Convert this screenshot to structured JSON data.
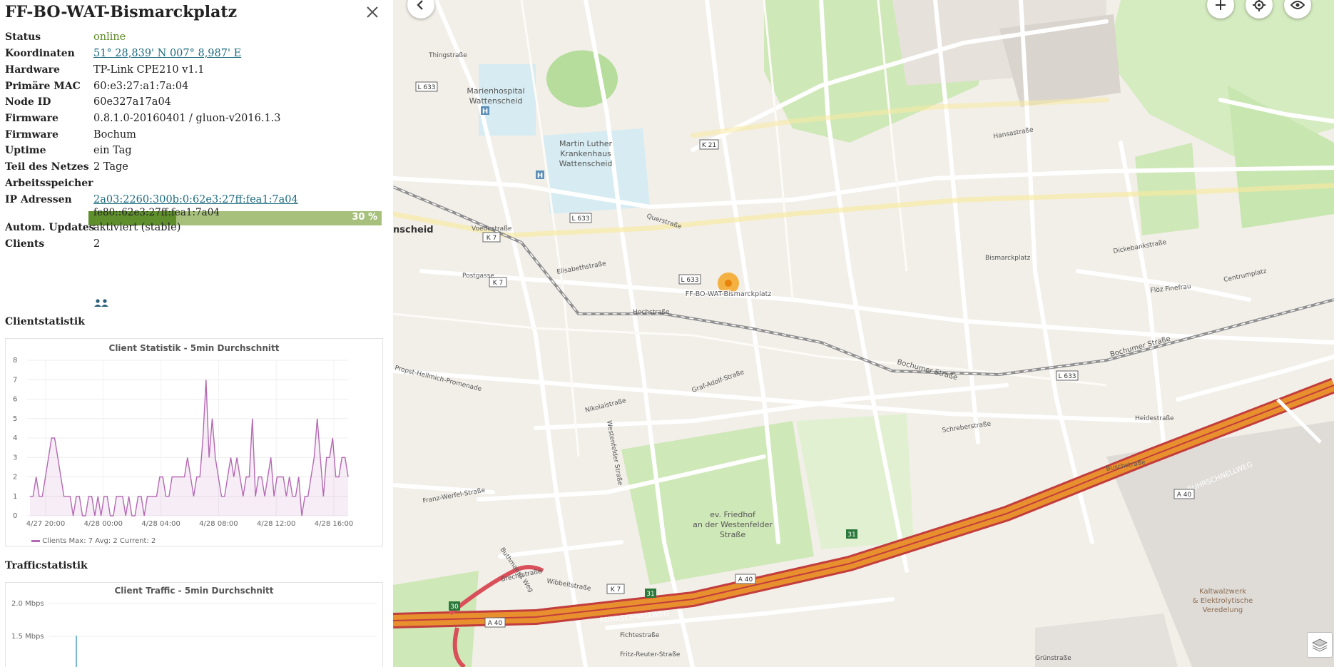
{
  "node": {
    "title": "FF-BO-WAT-Bismarckplatz",
    "fields": {
      "status": {
        "label": "Status",
        "value": "online"
      },
      "coords": {
        "label": "Koordinaten",
        "value": "51° 28,839' N 007° 8,987' E"
      },
      "hardware": {
        "label": "Hardware",
        "value": "TP-Link CPE210 v1.1"
      },
      "mac": {
        "label": "Primäre MAC",
        "value": "60:e3:27:a1:7a:04"
      },
      "nodeid": {
        "label": "Node ID",
        "value": "60e327a17a04"
      },
      "firmware": {
        "label": "Firmware",
        "value": "0.8.1.0-20160401 / gluon-v2016.1.3"
      },
      "site": {
        "label": "Firmware",
        "value": "Bochum"
      },
      "uptime": {
        "label": "Uptime",
        "value": "ein Tag"
      },
      "network": {
        "label": "Teil des Netzes",
        "value": "2 Tage"
      },
      "memory": {
        "label": "Arbeitsspeicher",
        "text": "30 %",
        "fraction": 0.3
      },
      "ip": {
        "label": "IP Adressen",
        "addr1": "2a03:2260:300b:0:62e3:27ff:fea1:7a04",
        "addr2": "fe80::62e3:27ff:fea1:7a04"
      },
      "updates": {
        "label": "Autom. Updates",
        "value": "aktiviert (stable)"
      },
      "clients": {
        "label": "Clients",
        "value": "2",
        "icon": "users-icon"
      }
    },
    "client_section": "Clientstatistik",
    "traffic_section": "Trafficstatistik"
  },
  "chart_data": [
    {
      "type": "line",
      "title": "Client Statistik - 5min Durchschnitt",
      "x_ticks": [
        "4/27 20:00",
        "4/28 00:00",
        "4/28 04:00",
        "4/28 08:00",
        "4/28 12:00",
        "4/28 16:00"
      ],
      "y_ticks": [
        "0",
        "1",
        "2",
        "3",
        "4",
        "5",
        "6",
        "7",
        "8"
      ],
      "ylim": [
        0,
        8
      ],
      "series": [
        {
          "name": "Clients",
          "color": "#b569b3",
          "values": [
            1,
            1,
            2,
            1,
            1,
            2,
            3,
            4,
            4,
            3,
            2,
            1,
            1,
            1,
            0,
            1,
            1,
            0,
            0,
            1,
            1,
            0,
            1,
            0,
            1,
            1,
            0,
            0,
            1,
            1,
            1,
            0,
            1,
            0,
            0,
            1,
            1,
            0,
            1,
            1,
            1,
            1,
            2,
            2,
            1,
            1,
            2,
            2,
            2,
            2,
            2,
            3,
            2,
            1,
            2,
            2,
            4,
            7,
            3,
            5,
            3,
            2,
            1,
            1,
            2,
            3,
            2,
            3,
            2,
            1,
            2,
            2,
            5,
            1,
            2,
            2,
            1,
            2,
            3,
            1,
            2,
            2,
            2,
            1,
            2,
            1,
            1,
            2,
            0,
            1,
            1,
            2,
            3,
            5,
            3,
            1,
            3,
            3,
            4,
            2,
            2,
            3,
            3,
            2
          ]
        }
      ],
      "legend": {
        "name": "Clients",
        "stats": "Max: 7   Avg: 2   Current: 2"
      }
    },
    {
      "type": "line",
      "title": "Client Traffic - 5min Durchschnitt",
      "y_ticks": [
        "2.0 Mbps",
        "1.5 Mbps"
      ],
      "series": []
    }
  ],
  "map": {
    "node_label": "FF-BO-WAT-Bismarckplatz",
    "colors": {
      "node": "#f5a623",
      "motorway": "#e8373d",
      "railway": "#8c8c8c",
      "green": "#c8e6b0",
      "road": "#ffffff"
    },
    "controls": {
      "back": "chevron-left-icon",
      "zoom": "plus-icon",
      "locate": "locate-icon",
      "view": "eye-icon",
      "layers": "layers-icon"
    },
    "labels": {
      "marienhospital": [
        "Marienhospital",
        "Wattenscheid"
      ],
      "krankenhaus": [
        "Martin Luther",
        "Krankenhaus",
        "Wattenscheid"
      ],
      "friedhof": [
        "ev. Friedhof",
        "an der Westenfelder",
        "Straße"
      ],
      "kaltwalzwerk": [
        "Kaltwalzwerk",
        "& Elektrolytische",
        "Veredelung"
      ],
      "wattenscheid": "nscheid",
      "streets": {
        "voedestrasse": "Voedestraße",
        "querstrasse": "Querstraße",
        "hochstrasse": "Hochstraße",
        "bochumer": "Bochumer Straße",
        "ruhrschnellweg": "RUHRSCHNELLWEG",
        "bismarckplatz": "Bismarckplatz",
        "hansastrasse": "Hansastraße",
        "heidestrasse": "Heidestraße",
        "schreberstrasse": "Schreberstraße",
        "elisabethstrasse": "Elisabethstraße",
        "postgasse": "Postgasse",
        "thingstrasse": "Thingstraße",
        "westenfelder": "Westenfelder Straße",
        "graf_adolf": "Graf-Adolf-Straße",
        "nikolaistrasse": "Nikolaistraße",
        "propst": "Propst-Hellmich-Promenade",
        "franz_werfel": "Franz-Werfel-Straße",
        "fichtestrasse": "Fichtestraße",
        "fritz_reuter": "Fritz-Reuter-Straße",
        "buschstrasse": "Buschstraße",
        "dickebankstrasse": "Dickebankstraße",
        "centrumplatz": "Centrumplatz",
        "floz": "Flöz Finefrau",
        "wibbeltstrasse": "Wibbeltstraße",
        "brechtstrasse": "Brechtstraße",
        "buthmanns": "Buthmanns Weg",
        "gruenstrasse": "Grünstraße"
      },
      "shields": {
        "l633": "L 633",
        "k7": "K 7",
        "k21": "K 21",
        "a40": "A 40"
      },
      "exits": {
        "e30": "30",
        "e31": "31"
      }
    }
  }
}
